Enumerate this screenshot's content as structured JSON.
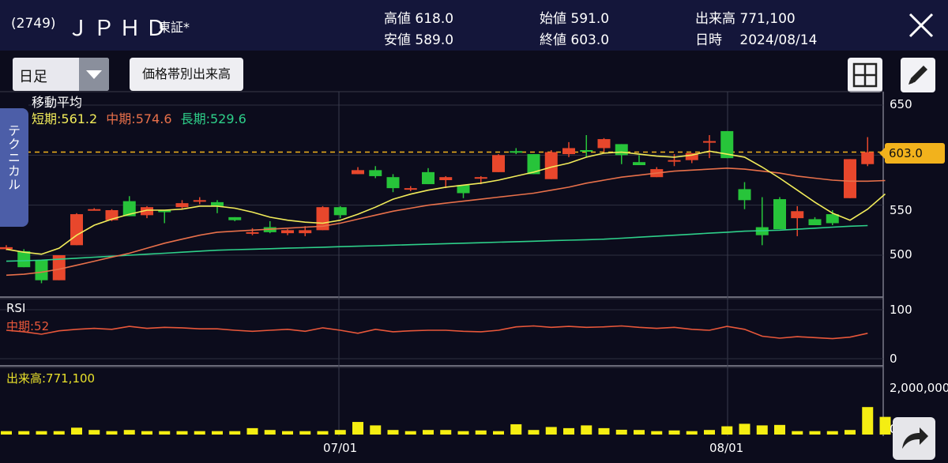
{
  "header": {
    "code": "(2749)",
    "name": "ＪＰＨＤ",
    "exchange": "東証*",
    "high": "高値 618.0",
    "low": "安値 589.0",
    "open": "始値 591.0",
    "close": "終値 603.0",
    "volume": "出来高 771,100",
    "datetime": "日時　 2024/08/14"
  },
  "toolbar": {
    "period_select": "日足",
    "volume_profile_button": "価格帯別出来高"
  },
  "side_tab": "テクニカル",
  "moving_average": {
    "title": "移動平均",
    "short": "短期:561.2",
    "mid": "中期:574.6",
    "long": "長期:529.6"
  },
  "rsi": {
    "title": "RSI",
    "mid": "中期:52"
  },
  "volume_panel": {
    "title": "出来高:771,100"
  },
  "price_axis": [
    "650",
    "550",
    "500"
  ],
  "current_price_tag": "603.0",
  "rsi_axis": [
    "100",
    "0"
  ],
  "volume_axis": [
    "2,000,000",
    "0"
  ],
  "dates": [
    "07/01",
    "08/01"
  ],
  "colors": {
    "up": "#e8472c",
    "down": "#27c43a",
    "ma_short": "#f2ec5a",
    "ma_mid": "#e8704a",
    "ma_long": "#2ed08a",
    "rsi": "#e8573a",
    "volume": "#f5ee12",
    "price_line": "#f2b21c"
  },
  "chart_data": {
    "type": "candlestick",
    "price_ylim": [
      485,
      665
    ],
    "current_price": 603.0,
    "candles": [
      {
        "o": 508,
        "h": 510,
        "l": 505,
        "c": 506,
        "up": true
      },
      {
        "o": 504,
        "h": 506,
        "l": 488,
        "c": 488,
        "up": false
      },
      {
        "o": 495,
        "h": 495,
        "l": 472,
        "c": 475,
        "up": false
      },
      {
        "o": 475,
        "h": 500,
        "l": 475,
        "c": 500,
        "up": true
      },
      {
        "o": 510,
        "h": 542,
        "l": 510,
        "c": 541,
        "up": true
      },
      {
        "o": 546,
        "h": 547,
        "l": 545,
        "c": 545.5,
        "up": true
      },
      {
        "o": 545,
        "h": 546,
        "l": 534,
        "c": 535,
        "up": true
      },
      {
        "o": 554,
        "h": 559,
        "l": 539,
        "c": 539,
        "up": false
      },
      {
        "o": 540,
        "h": 549,
        "l": 537,
        "c": 548,
        "up": true
      },
      {
        "o": 545,
        "h": 545,
        "l": 532,
        "c": 543,
        "up": false
      },
      {
        "o": 548,
        "h": 555,
        "l": 546,
        "c": 552,
        "up": true
      },
      {
        "o": 555,
        "h": 558,
        "l": 551,
        "c": 555,
        "up": true
      },
      {
        "o": 553,
        "h": 555,
        "l": 542,
        "c": 549,
        "up": false
      },
      {
        "o": 538,
        "h": 538,
        "l": 534,
        "c": 535,
        "up": false
      },
      {
        "o": 522,
        "h": 527,
        "l": 520,
        "c": 523,
        "up": true
      },
      {
        "o": 528,
        "h": 534,
        "l": 522,
        "c": 523,
        "up": false
      },
      {
        "o": 525,
        "h": 526,
        "l": 520,
        "c": 522,
        "up": true
      },
      {
        "o": 522,
        "h": 529,
        "l": 519,
        "c": 525,
        "up": true
      },
      {
        "o": 525,
        "h": 549,
        "l": 525,
        "c": 548,
        "up": true
      },
      {
        "o": 548,
        "h": 549,
        "l": 537,
        "c": 540,
        "up": false
      },
      {
        "o": 581,
        "h": 588,
        "l": 581,
        "c": 585,
        "up": true
      },
      {
        "o": 585,
        "h": 589,
        "l": 577,
        "c": 579,
        "up": false
      },
      {
        "o": 578,
        "h": 581,
        "l": 563,
        "c": 567,
        "up": false
      },
      {
        "o": 567,
        "h": 569,
        "l": 564,
        "c": 567,
        "up": true
      },
      {
        "o": 583,
        "h": 587,
        "l": 571,
        "c": 571,
        "up": false
      },
      {
        "o": 575,
        "h": 579,
        "l": 567,
        "c": 578,
        "up": true
      },
      {
        "o": 570,
        "h": 570,
        "l": 557,
        "c": 562,
        "up": false
      },
      {
        "o": 578,
        "h": 579,
        "l": 571,
        "c": 578,
        "up": true
      },
      {
        "o": 583,
        "h": 601,
        "l": 583,
        "c": 600,
        "up": true
      },
      {
        "o": 604,
        "h": 607,
        "l": 601,
        "c": 603,
        "up": false
      },
      {
        "o": 601,
        "h": 601,
        "l": 586,
        "c": 581,
        "up": false
      },
      {
        "o": 576,
        "h": 605,
        "l": 576,
        "c": 603,
        "up": true
      },
      {
        "o": 601,
        "h": 613,
        "l": 598,
        "c": 607,
        "up": true
      },
      {
        "o": 605,
        "h": 620,
        "l": 598,
        "c": 605,
        "up": false
      },
      {
        "o": 607,
        "h": 617,
        "l": 603,
        "c": 616,
        "up": true
      },
      {
        "o": 611,
        "h": 611,
        "l": 591,
        "c": 600,
        "up": false
      },
      {
        "o": 590,
        "h": 600,
        "l": 590,
        "c": 593,
        "up": false
      },
      {
        "o": 578,
        "h": 588,
        "l": 578,
        "c": 586,
        "up": true
      },
      {
        "o": 595,
        "h": 601,
        "l": 589,
        "c": 595,
        "up": true
      },
      {
        "o": 595,
        "h": 601,
        "l": 592,
        "c": 602,
        "up": true
      },
      {
        "o": 614,
        "h": 620,
        "l": 597,
        "c": 613,
        "up": true
      },
      {
        "o": 624,
        "h": 624,
        "l": 597,
        "c": 597,
        "up": false
      },
      {
        "o": 566,
        "h": 573,
        "l": 546,
        "c": 555,
        "up": false
      },
      {
        "o": 528,
        "h": 558,
        "l": 510,
        "c": 520,
        "up": false
      },
      {
        "o": 556,
        "h": 558,
        "l": 527,
        "c": 526,
        "up": false
      },
      {
        "o": 537,
        "h": 549,
        "l": 519,
        "c": 544,
        "up": true
      },
      {
        "o": 536,
        "h": 538,
        "l": 530,
        "c": 530,
        "up": false
      },
      {
        "o": 541,
        "h": 545,
        "l": 530,
        "c": 532,
        "up": false
      },
      {
        "o": 557,
        "h": 575,
        "l": 557,
        "c": 596,
        "up": true
      },
      {
        "o": 591,
        "h": 618,
        "l": 589,
        "c": 603,
        "up": true
      }
    ],
    "ma_short": [
      506,
      503,
      501,
      507,
      520,
      530,
      536,
      541,
      545,
      545,
      546,
      549,
      549,
      547,
      543,
      538,
      535,
      533,
      532,
      535,
      541,
      548,
      556,
      561,
      565,
      568,
      570,
      572,
      575,
      579,
      583,
      588,
      592,
      598,
      602,
      603,
      601,
      599,
      598,
      600,
      604,
      601,
      598,
      588,
      577,
      565,
      553,
      542,
      535,
      546,
      561.2
    ],
    "ma_mid": [
      480,
      481,
      483,
      486,
      490,
      494,
      498,
      502,
      507,
      512,
      516,
      520,
      523,
      524,
      525,
      526,
      527,
      528,
      529,
      532,
      536,
      540,
      544,
      547,
      550,
      552,
      554,
      556,
      558,
      560,
      562,
      565,
      568,
      572,
      575,
      578,
      580,
      582,
      584,
      585,
      586,
      587,
      586,
      584,
      582,
      579,
      577,
      575,
      574,
      574,
      574.6
    ],
    "ma_long": [
      494,
      494.5,
      495,
      496,
      497,
      498,
      499,
      500,
      501,
      502,
      503,
      504,
      505,
      505.5,
      506,
      506.5,
      507,
      507.5,
      508,
      508.5,
      509,
      509.5,
      510,
      510.5,
      511,
      511.5,
      512,
      512.5,
      513,
      513.5,
      514,
      514.5,
      515,
      515.5,
      516,
      517,
      518,
      519,
      520,
      521,
      522,
      523,
      524,
      524.5,
      525,
      526,
      527,
      528,
      529,
      529.6
    ],
    "rsi_ylim": [
      0,
      100
    ],
    "rsi": [
      58,
      55,
      50,
      57,
      60,
      62,
      60,
      66,
      62,
      64,
      63,
      61,
      61,
      58,
      56,
      58,
      60,
      56,
      63,
      58,
      52,
      60,
      55,
      57,
      58,
      58,
      56,
      55,
      58,
      65,
      67,
      64,
      66,
      64,
      65,
      67,
      64,
      62,
      64,
      60,
      58,
      66,
      60,
      46,
      42,
      45,
      43,
      41,
      44,
      52
    ],
    "volume_ylim": [
      0,
      2000000
    ],
    "volume": [
      150000,
      150000,
      150000,
      150000,
      300000,
      200000,
      150000,
      200000,
      150000,
      150000,
      150000,
      150000,
      150000,
      150000,
      280000,
      200000,
      150000,
      150000,
      150000,
      200000,
      550000,
      400000,
      200000,
      150000,
      200000,
      200000,
      150000,
      180000,
      150000,
      450000,
      200000,
      330000,
      280000,
      400000,
      280000,
      210000,
      200000,
      150000,
      180000,
      150000,
      200000,
      360000,
      470000,
      400000,
      420000,
      150000,
      150000,
      150000,
      200000,
      1200000,
      771100
    ]
  }
}
